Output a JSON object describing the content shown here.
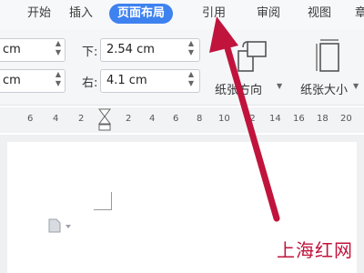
{
  "tabs": [
    {
      "label": "开始"
    },
    {
      "label": "插入"
    },
    {
      "label": "页面布局"
    },
    {
      "label": "引用"
    },
    {
      "label": "审阅"
    },
    {
      "label": "视图"
    },
    {
      "label": "章"
    }
  ],
  "margins": {
    "left_value": "cm",
    "left_value2": "cm",
    "bottom_label": "下:",
    "bottom_value": "2.54 cm",
    "right_label": "右:",
    "right_value": "4.1 cm"
  },
  "ribbon": {
    "orientation_label": "纸张方向",
    "size_label": "纸张大小"
  },
  "ruler": {
    "left_ticks": [
      "6",
      "4",
      "2"
    ],
    "right_ticks": [
      "2",
      "4",
      "6",
      "8",
      "10",
      "12",
      "14",
      "16",
      "18",
      "20"
    ]
  },
  "watermark": "上海红网",
  "colors": {
    "accent": "#3e82f0",
    "arrow": "#c0143c"
  }
}
